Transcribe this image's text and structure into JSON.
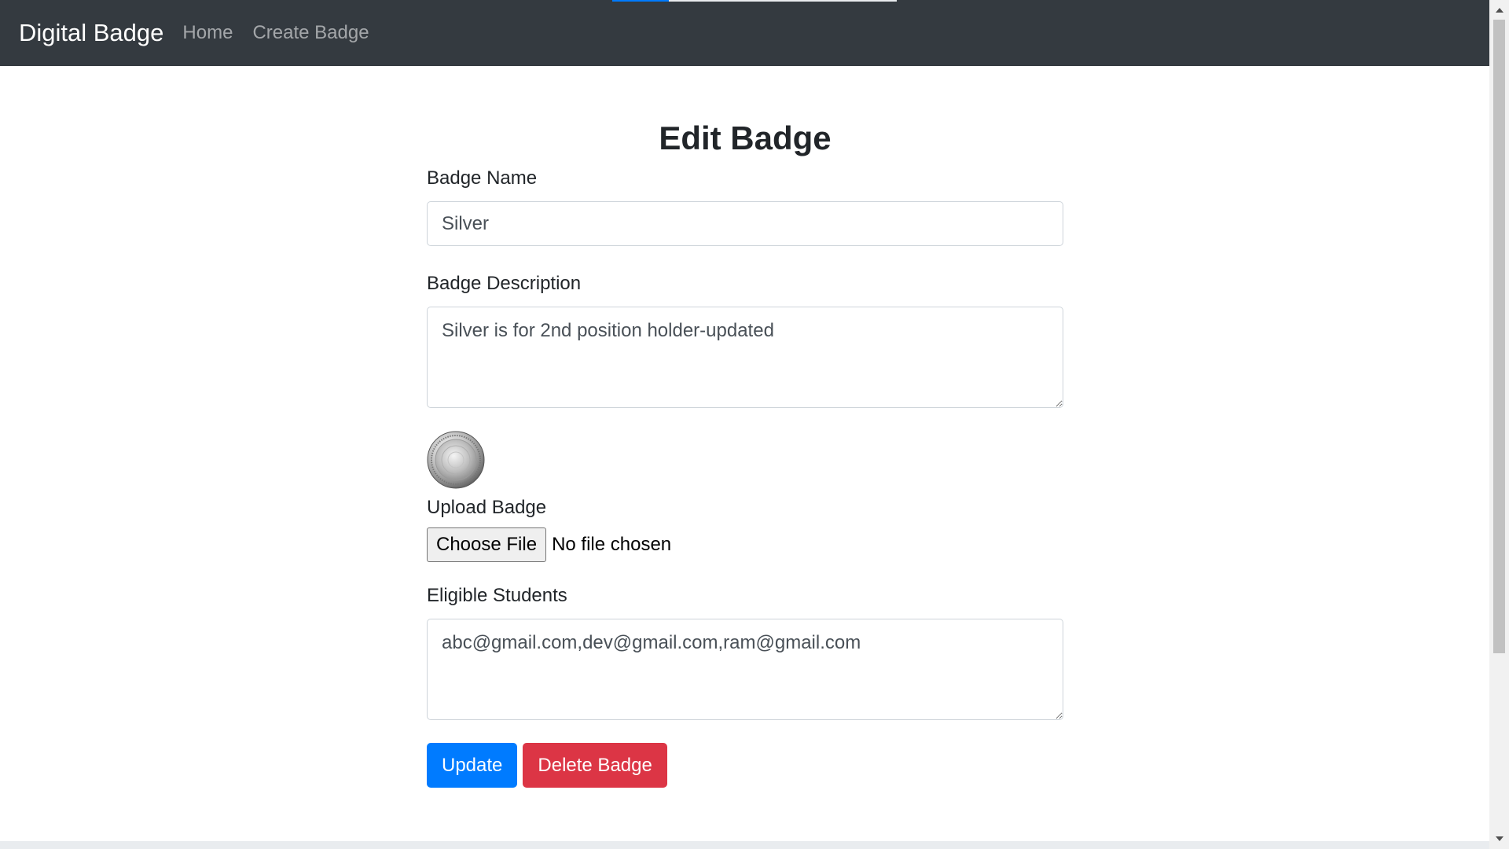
{
  "navbar": {
    "brand": "Digital Badge",
    "links": [
      "Home",
      "Create Badge"
    ],
    "loading_progress": 0.2
  },
  "page": {
    "title": "Edit Badge"
  },
  "form": {
    "name": {
      "label": "Badge Name",
      "value": "Silver"
    },
    "description": {
      "label": "Badge Description",
      "value": "Silver is for 2nd position holder-updated"
    },
    "badge_image_icon": "silver-medal-icon",
    "upload": {
      "label": "Upload Badge",
      "button_label": "Choose File",
      "status": "No file chosen"
    },
    "students": {
      "label": "Eligible Students",
      "value": "abc@gmail.com,dev@gmail.com,ram@gmail.com"
    },
    "buttons": {
      "update": "Update",
      "delete": "Delete Badge"
    }
  },
  "colors": {
    "navbar_bg": "#343a40",
    "primary": "#007bff",
    "danger": "#dc3545"
  }
}
